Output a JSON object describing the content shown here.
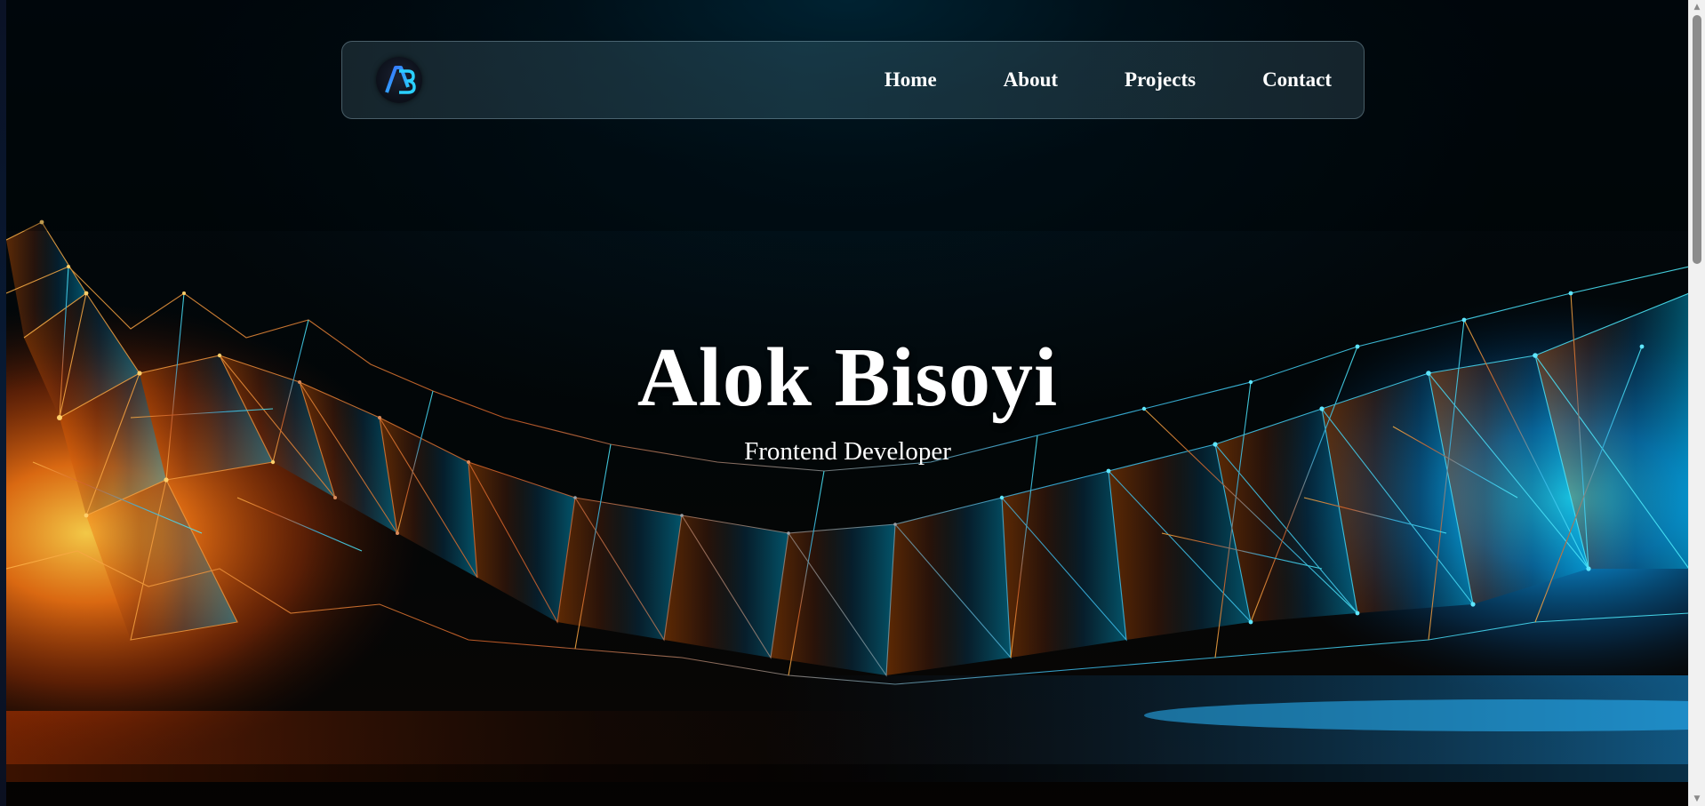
{
  "brand": {
    "logo_letters": "AB"
  },
  "nav": {
    "items": [
      {
        "label": "Home"
      },
      {
        "label": "About"
      },
      {
        "label": "Projects"
      },
      {
        "label": "Contact"
      }
    ]
  },
  "hero": {
    "title": "Alok Bisoyi",
    "subtitle": "Frontend Developer"
  },
  "colors": {
    "accent_orange": "#ff6a1a",
    "accent_blue": "#19b8ff",
    "text": "#ffffff",
    "background": "#020607"
  },
  "icons": {
    "logo": "ab-monogram-icon",
    "scroll_up": "triangle-up-icon",
    "scroll_down": "triangle-down-icon"
  }
}
